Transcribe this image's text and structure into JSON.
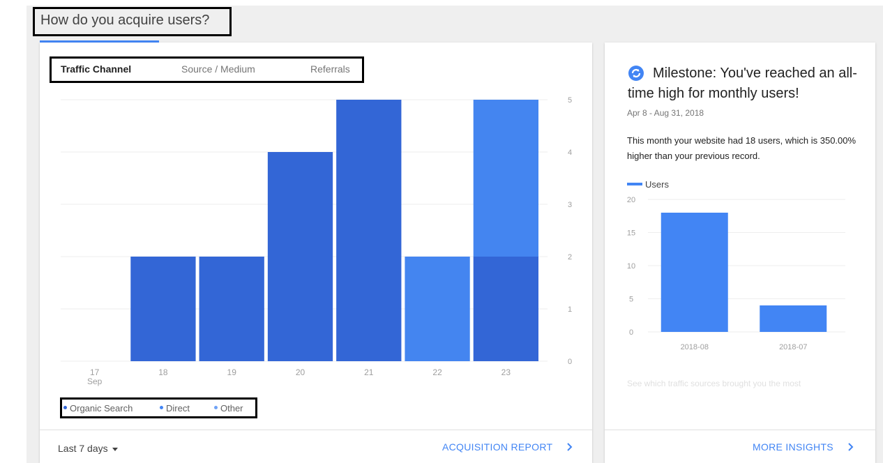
{
  "section": {
    "title": "How do you acquire users?"
  },
  "tabs": [
    {
      "label": "Traffic Channel",
      "active": true
    },
    {
      "label": "Source / Medium",
      "active": false
    },
    {
      "label": "Referrals",
      "active": false
    }
  ],
  "chart_data": [
    {
      "type": "bar",
      "stacked": true,
      "categories": [
        "17",
        "18",
        "19",
        "20",
        "21",
        "22",
        "23"
      ],
      "category_sublabels": [
        "Sep",
        "",
        "",
        "",
        "",
        "",
        ""
      ],
      "series": [
        {
          "name": "Organic Search",
          "color": "#3366d6",
          "values": [
            0,
            2,
            2,
            4,
            5,
            0,
            2
          ]
        },
        {
          "name": "Direct",
          "color": "#4285f4",
          "values": [
            0,
            0,
            0,
            0,
            0,
            2,
            3
          ]
        },
        {
          "name": "Other",
          "color": "#4a90f0",
          "values": [
            0,
            0,
            0,
            0,
            0,
            0,
            0
          ]
        }
      ],
      "ylim": [
        0,
        5
      ],
      "yticks": [
        "0",
        "1",
        "2",
        "3",
        "4",
        "5"
      ],
      "y_axis_position": "right",
      "grid": true,
      "legend": "bottom-left"
    },
    {
      "type": "bar",
      "categories": [
        "2018-08",
        "2018-07"
      ],
      "series": [
        {
          "name": "Users",
          "color": "#4285f4",
          "values": [
            18,
            4
          ]
        }
      ],
      "ylim": [
        0,
        20
      ],
      "yticks": [
        "0",
        "5",
        "10",
        "15",
        "20"
      ],
      "grid": true,
      "legend": "top-left"
    }
  ],
  "footer": {
    "date_range": "Last 7 days",
    "report_link": "ACQUISITION REPORT"
  },
  "milestone": {
    "title": "Milestone: You've reached an all-time high for monthly users!",
    "date_range": "Apr 8 - Aug 31, 2018",
    "body": "This month your website had 18 users, which is 350.00% higher than your previous record.",
    "legend_label": "Users",
    "faded_text": "See which traffic sources brought you the most",
    "insights_link": "MORE INSIGHTS"
  },
  "colors": {
    "accent": "#4285f4",
    "dark_bar": "#3366d6"
  }
}
